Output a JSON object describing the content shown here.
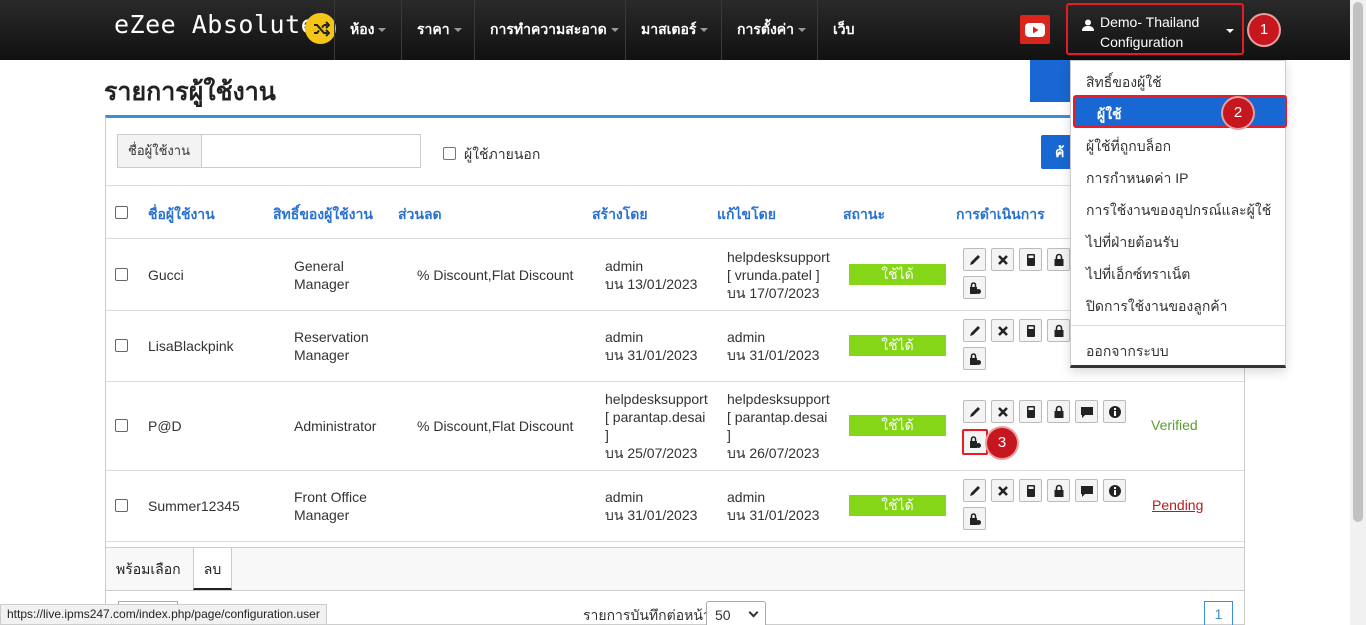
{
  "topbar": {
    "brand": "eZee Absolute",
    "nav": [
      {
        "label": "ห้อง"
      },
      {
        "label": "ราคา"
      },
      {
        "label": "การทำความสะอาด"
      },
      {
        "label": "มาสเตอร์"
      },
      {
        "label": "การตั้งค่า"
      },
      {
        "label": "เว็บ"
      }
    ],
    "user_line1": "Demo- Thailand",
    "user_line2": "Configuration"
  },
  "badges": [
    "1",
    "2",
    "3"
  ],
  "dropdown": {
    "items": [
      "สิทธิ์ของผู้ใช้",
      "ผู้ใช้",
      "ผู้ใช้ที่ถูกบล็อก",
      "การกำหนดค่า IP",
      "การใช้งานของอุปกรณ์และผู้ใช้",
      "ไปที่ฝ่ายต้อนรับ",
      "ไปที่เอ็กซ์ทราเน็ต",
      "ปิดการใช้งานของลูกค้า",
      "ออกจากระบบ"
    ]
  },
  "page": {
    "title": "รายการผู้ใช้งาน",
    "filter_label": "ชื่อผู้ใช้งาน",
    "filter_value": "",
    "external_label": "ผู้ใช้ภายนอก",
    "search_label": "ค้"
  },
  "table": {
    "headers": [
      "ชื่อผู้ใช้งาน",
      "สิทธิ์ของผู้ใช้งาน",
      "ส่วนลด",
      "สร้างโดย",
      "แก้ไขโดย",
      "สถานะ",
      "การดำเนินการ"
    ],
    "rows": [
      {
        "name": "Gucci",
        "role1": "General",
        "role2": "Manager",
        "discount": "% Discount,Flat Discount",
        "created": [
          "admin",
          "บน 13/01/2023"
        ],
        "modified": [
          "helpdesksupport",
          "[ vrunda.patel ]",
          "บน 17/07/2023"
        ],
        "status": "ใช้ได้",
        "verify": ""
      },
      {
        "name": "LisaBlackpink",
        "role1": "Reservation",
        "role2": "Manager",
        "discount": "",
        "created": [
          "admin",
          "บน 31/01/2023"
        ],
        "modified": [
          "admin",
          "บน 31/01/2023"
        ],
        "status": "ใช้ได้",
        "verify": ""
      },
      {
        "name": "P@D",
        "role1": "Administrator",
        "role2": "",
        "discount": "% Discount,Flat Discount",
        "created": [
          "helpdesksupport",
          "[ parantap.desai",
          "]",
          "บน 25/07/2023"
        ],
        "modified": [
          "helpdesksupport",
          "[ parantap.desai",
          "]",
          "บน 26/07/2023"
        ],
        "status": "ใช้ได้",
        "verify": "Verified"
      },
      {
        "name": "Summer12345",
        "role1": "Front Office",
        "role2": "Manager",
        "discount": "",
        "created": [
          "admin",
          "บน 31/01/2023"
        ],
        "modified": [
          "admin",
          "บน 31/01/2023"
        ],
        "status": "ใช้ได้",
        "verify": "Pending"
      }
    ]
  },
  "footer": {
    "tab_ready": "พร้อมเลือก",
    "tab_delete": "ลบ",
    "per_page_label": "รายการบันทึกต่อหน้า",
    "per_page_value": "50",
    "page_number": "1"
  },
  "statusbar": "https://live.ipms247.com/index.php/page/configuration.user",
  "colors": {
    "accent": "#1967d2",
    "status_green": "#84d617",
    "highlight": "#e81c24"
  }
}
